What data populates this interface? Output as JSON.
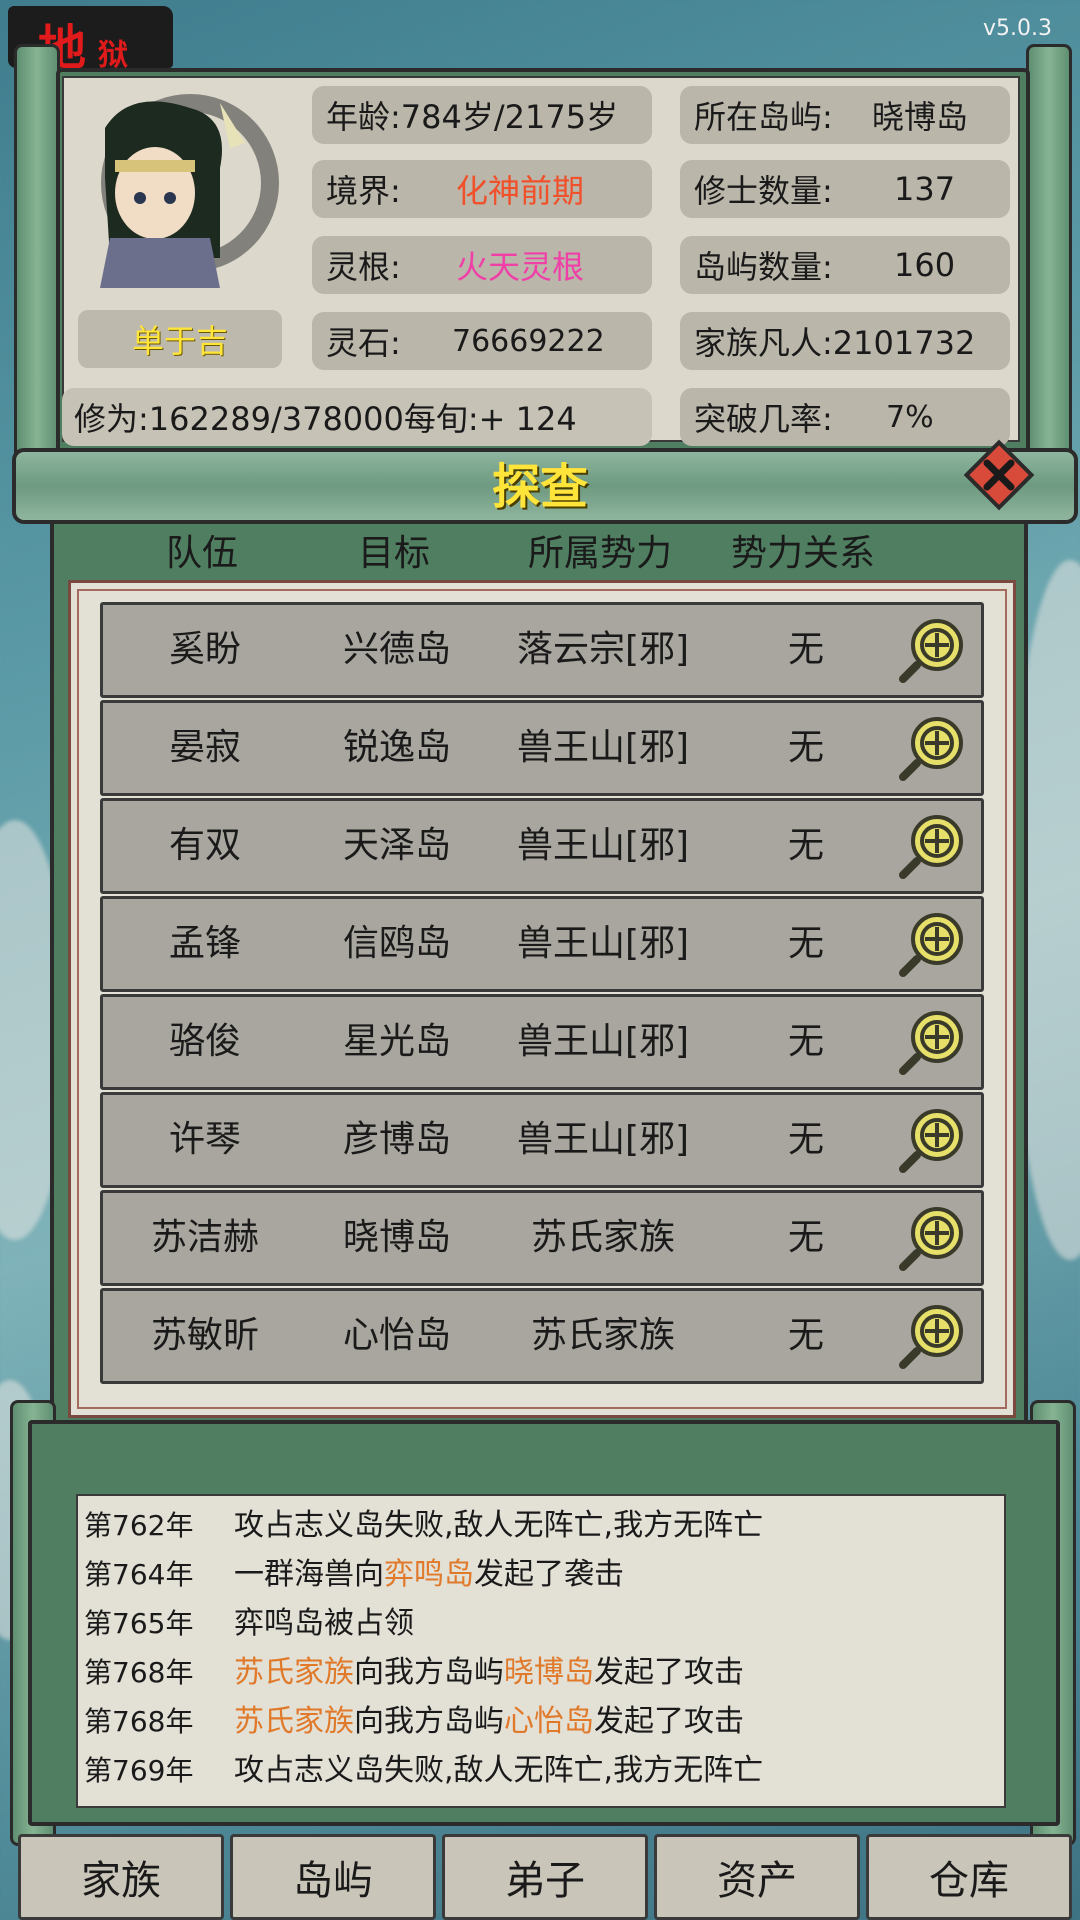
{
  "hell_badge": {
    "big": "地",
    "small": "狱"
  },
  "version": "v5.0.3",
  "player": {
    "name": "单于吉",
    "age": "年龄:784岁/2175岁",
    "realm_label": "境界:",
    "realm_value": "化神前期",
    "root_label": "灵根:",
    "root_value": "火天灵根",
    "stones_label": "灵石:",
    "stones_value": "76669222",
    "cultivation": "修为:162289/378000每旬:+ 124"
  },
  "island_stats": {
    "island_label": "所在岛屿:",
    "island_value": "晓博岛",
    "cultivators_label": "修士数量:",
    "cultivators_value": "137",
    "islands_label": "岛屿数量:",
    "islands_value": "160",
    "mortals": "家族凡人:2101732",
    "breakthrough_label": "突破几率:",
    "breakthrough_value": "7%"
  },
  "explore": {
    "title": "探查",
    "headers": [
      "队伍",
      "目标",
      "所属势力",
      "势力关系"
    ],
    "rows": [
      {
        "team": "奚盼",
        "target": "兴德岛",
        "faction": "落云宗[邪]",
        "relation": "无"
      },
      {
        "team": "晏寂",
        "target": "锐逸岛",
        "faction": "兽王山[邪]",
        "relation": "无"
      },
      {
        "team": "有双",
        "target": "天泽岛",
        "faction": "兽王山[邪]",
        "relation": "无"
      },
      {
        "team": "孟锋",
        "target": "信鸥岛",
        "faction": "兽王山[邪]",
        "relation": "无"
      },
      {
        "team": "骆俊",
        "target": "星光岛",
        "faction": "兽王山[邪]",
        "relation": "无"
      },
      {
        "team": "许琴",
        "target": "彦博岛",
        "faction": "兽王山[邪]",
        "relation": "无"
      },
      {
        "team": "苏洁赫",
        "target": "晓博岛",
        "faction": "苏氏家族",
        "relation": "无"
      },
      {
        "team": "苏敏昕",
        "target": "心怡岛",
        "faction": "苏氏家族",
        "relation": "无"
      }
    ]
  },
  "log": [
    {
      "year": "第762年",
      "parts": [
        {
          "t": "攻占志义岛失败,敌人无阵亡,我方无阵亡",
          "hl": false
        }
      ]
    },
    {
      "year": "第764年",
      "parts": [
        {
          "t": "一群海兽向",
          "hl": false
        },
        {
          "t": "弈鸣岛",
          "hl": true
        },
        {
          "t": "发起了袭击",
          "hl": false
        }
      ]
    },
    {
      "year": "第765年",
      "parts": [
        {
          "t": "弈鸣岛被占领",
          "hl": false
        }
      ]
    },
    {
      "year": "第768年",
      "parts": [
        {
          "t": "苏氏家族",
          "hl": true
        },
        {
          "t": "向我方岛屿",
          "hl": false
        },
        {
          "t": "晓博岛",
          "hl": true
        },
        {
          "t": "发起了攻击",
          "hl": false
        }
      ]
    },
    {
      "year": "第768年",
      "parts": [
        {
          "t": "苏氏家族",
          "hl": true
        },
        {
          "t": "向我方岛屿",
          "hl": false
        },
        {
          "t": "心怡岛",
          "hl": true
        },
        {
          "t": "发起了攻击",
          "hl": false
        }
      ]
    },
    {
      "year": "第769年",
      "parts": [
        {
          "t": "攻占志义岛失败,敌人无阵亡,我方无阵亡",
          "hl": false
        }
      ]
    }
  ],
  "nav": [
    "家族",
    "岛屿",
    "弟子",
    "资产",
    "仓库"
  ],
  "colors": {
    "frame_green": "#4f7e61",
    "title_yellow": "#ffe43a",
    "realm_red": "#f0502a",
    "root_pink": "#f040a8",
    "log_highlight": "#e07a2a"
  }
}
